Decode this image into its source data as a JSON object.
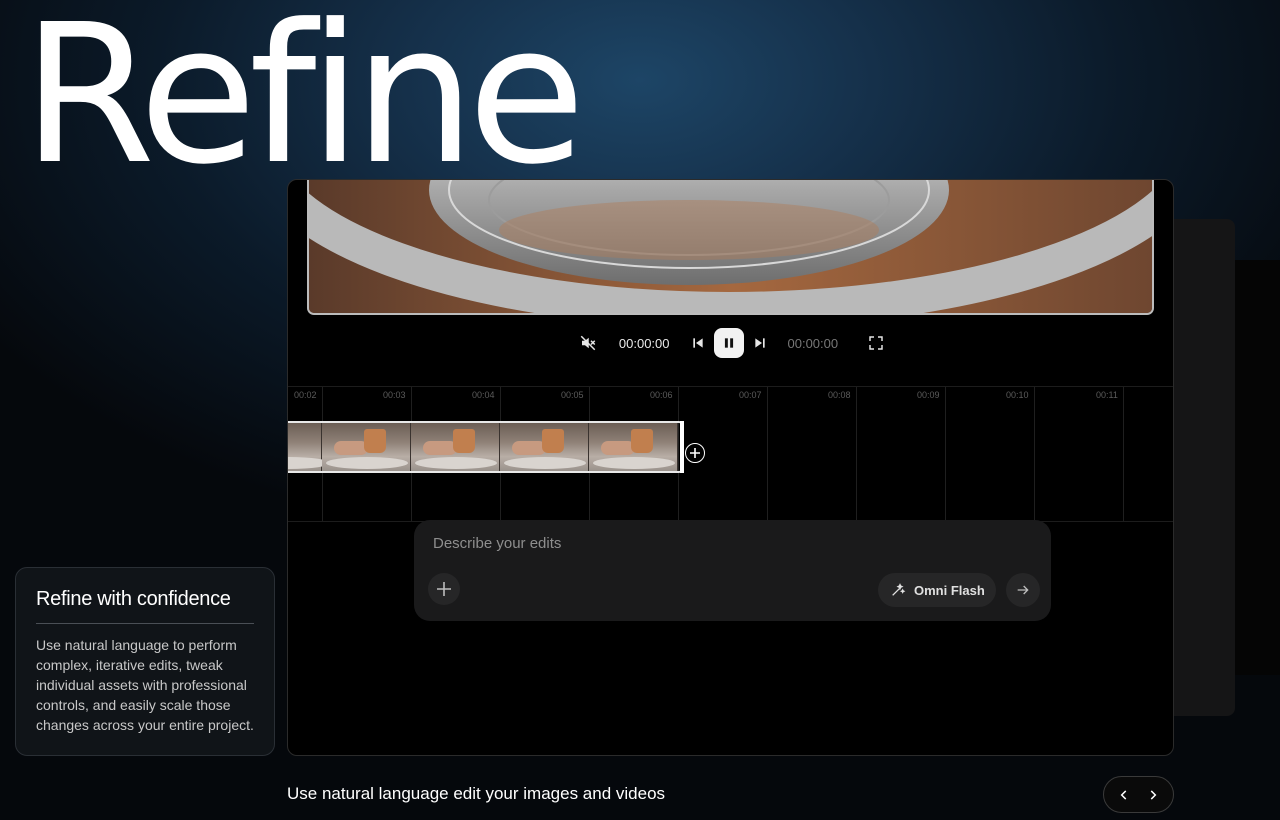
{
  "hero": {
    "title": "Refine"
  },
  "player": {
    "current_time": "00:00:00",
    "total_time": "00:00:00"
  },
  "timeline": {
    "ticks": [
      "00:02",
      "00:03",
      "00:04",
      "00:05",
      "00:06",
      "00:07",
      "00:08",
      "00:09",
      "00:10",
      "00:11"
    ]
  },
  "prompt": {
    "placeholder": "Describe your edits",
    "model_label": "Omni Flash"
  },
  "info_card": {
    "title": "Refine with confidence",
    "body": "Use natural language to perform complex, iterative edits, tweak individual assets with professional controls, and easily scale those changes across your entire project."
  },
  "caption": "Use natural language edit your images and videos",
  "icons": {
    "mute": "volume-muted-icon",
    "prev": "skip-previous-icon",
    "pause": "pause-icon",
    "next": "skip-next-icon",
    "fullscreen": "fullscreen-icon",
    "add": "plus-icon",
    "model": "magic-wand-icon",
    "send": "arrow-right-icon",
    "pager_prev": "chevron-left-icon",
    "pager_next": "chevron-right-icon"
  },
  "colors": {
    "background": "#05080c",
    "accent_glow": "#1d4566",
    "panel": "#000000",
    "prompt_box": "#1a1a1b",
    "clip_thumb_accent": "#c17f4e"
  }
}
